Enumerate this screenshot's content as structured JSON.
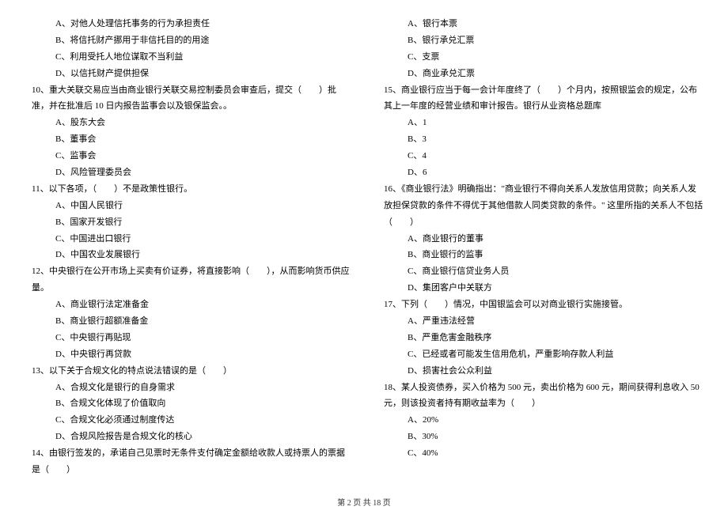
{
  "left": {
    "q9_opts": [
      "A、对他人处理信托事务的行为承担责任",
      "B、将信托财产挪用于非信托目的的用途",
      "C、利用受托人地位谋取不当利益",
      "D、以信托财产提供担保"
    ],
    "q10": "10、重大关联交易应当由商业银行关联交易控制委员会审查后，提交（　　）批准，并在批准后 10 日内报告监事会以及银保监会。。",
    "q10_opts": [
      "A、股东大会",
      "B、董事会",
      "C、监事会",
      "D、风险管理委员会"
    ],
    "q11": "11、以下各项，（　　）不是政策性银行。",
    "q11_opts": [
      "A、中国人民银行",
      "B、国家开发银行",
      "C、中国进出口银行",
      "D、中国农业发展银行"
    ],
    "q12": "12、中央银行在公开市场上买卖有价证券，将直接影响（　　），从而影响货币供应量。",
    "q12_opts": [
      "A、商业银行法定准备金",
      "B、商业银行超额准备金",
      "C、中央银行再贴现",
      "D、中央银行再贷款"
    ],
    "q13": "13、以下关于合规文化的特点说法错误的是（　　）",
    "q13_opts": [
      "A、合规文化是银行的自身需求",
      "B、合规文化体现了价值取向",
      "C、合规文化必须通过制度传达",
      "D、合规风险报告是合规文化的核心"
    ],
    "q14": "14、由银行签发的，承诺自己见票时无条件支付确定金额给收款人或持票人的票据是（　　）"
  },
  "right": {
    "q14_opts": [
      "A、银行本票",
      "B、银行承兑汇票",
      "C、支票",
      "D、商业承兑汇票"
    ],
    "q15": "15、商业银行应当于每一会计年度终了（　　）个月内，按照银监会的规定，公布其上一年度的经营业绩和审计报告。银行从业资格总题库",
    "q15_opts": [
      "A、1",
      "B、3",
      "C、4",
      "D、6"
    ],
    "q16": "16、《商业银行法》明确指出：\"商业银行不得向关系人发放信用贷款；向关系人发放担保贷款的条件不得优于其他借款人同类贷款的条件。\" 这里所指的关系人不包括（　　）",
    "q16_opts": [
      "A、商业银行的董事",
      "B、商业银行的监事",
      "C、商业银行信贷业务人员",
      "D、集团客户中关联方"
    ],
    "q17": "17、下列（　　）情况，中国银监会可以对商业银行实施接管。",
    "q17_opts": [
      "A、严重违法经营",
      "B、严重危害金融秩序",
      "C、已经或者可能发生信用危机，严重影响存款人利益",
      "D、损害社会公众利益"
    ],
    "q18": "18、某人投资债券，买入价格为 500 元，卖出价格为 600 元，期间获得利息收入 50 元，则该投资者持有期收益率为（　　）",
    "q18_opts": [
      "A、20%",
      "B、30%",
      "C、40%"
    ]
  },
  "footer": "第 2 页 共 18 页"
}
